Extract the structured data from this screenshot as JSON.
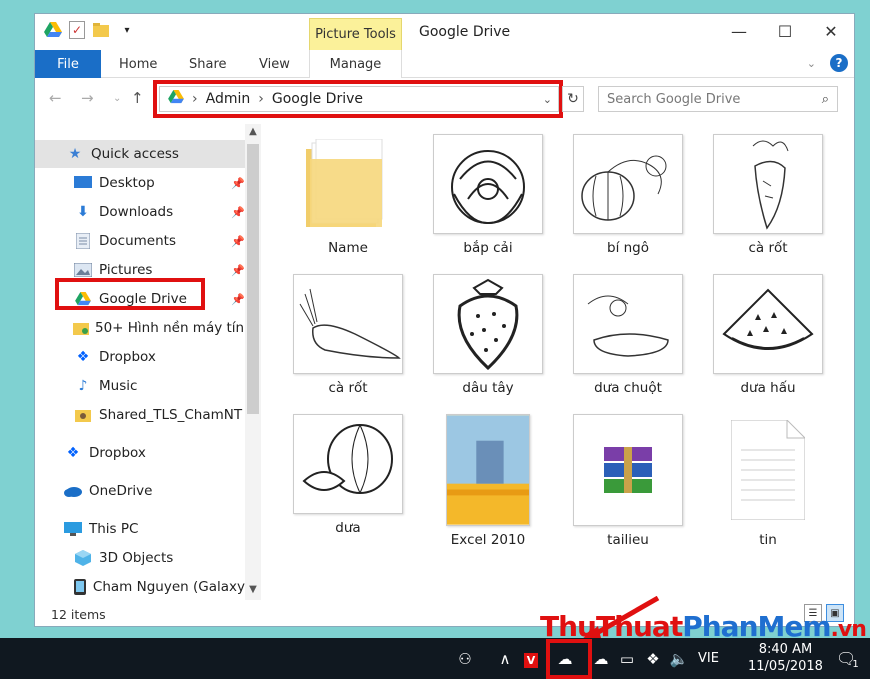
{
  "window": {
    "title": "Google Drive",
    "picture_tools": "Picture Tools",
    "controls": {
      "minimize": "—",
      "maximize": "☐",
      "close": "✕"
    }
  },
  "ribbon": {
    "tabs": [
      "File",
      "Home",
      "Share",
      "View",
      "Manage"
    ],
    "help": "?"
  },
  "address": {
    "crumbs": [
      "Admin",
      "Google Drive"
    ],
    "search_placeholder": "Search Google Drive"
  },
  "sidebar": {
    "items": [
      {
        "label": "Quick access",
        "icon": "star-icon"
      },
      {
        "label": "Desktop",
        "icon": "desktop-icon"
      },
      {
        "label": "Downloads",
        "icon": "download-icon"
      },
      {
        "label": "Documents",
        "icon": "documents-icon"
      },
      {
        "label": "Pictures",
        "icon": "pictures-icon"
      },
      {
        "label": "Google Drive",
        "icon": "google-drive-icon"
      },
      {
        "label": "50+ Hình nền máy tính",
        "icon": "folder-icon"
      },
      {
        "label": "Dropbox",
        "icon": "dropbox-icon"
      },
      {
        "label": "Music",
        "icon": "music-icon"
      },
      {
        "label": "Shared_TLS_ChamNT",
        "icon": "shared-folder-icon"
      },
      {
        "label": "Dropbox",
        "icon": "dropbox-icon"
      },
      {
        "label": "OneDrive",
        "icon": "onedrive-icon"
      },
      {
        "label": "This PC",
        "icon": "pc-icon"
      },
      {
        "label": "3D Objects",
        "icon": "3d-objects-icon"
      },
      {
        "label": "Cham Nguyen (Galaxy",
        "icon": "phone-icon"
      }
    ]
  },
  "files": [
    {
      "name": "Name",
      "kind": "folder"
    },
    {
      "name": "bắp cải",
      "kind": "image"
    },
    {
      "name": "bí ngô",
      "kind": "image"
    },
    {
      "name": "cà rốt",
      "kind": "image"
    },
    {
      "name": "cà rốt",
      "kind": "image"
    },
    {
      "name": "dâu tây",
      "kind": "image"
    },
    {
      "name": "dưa chuột",
      "kind": "image"
    },
    {
      "name": "dưa hấu",
      "kind": "image"
    },
    {
      "name": "dưa",
      "kind": "image"
    },
    {
      "name": "Excel 2010",
      "kind": "image"
    },
    {
      "name": "tailieu",
      "kind": "archive"
    },
    {
      "name": "tin",
      "kind": "document"
    }
  ],
  "status": {
    "count": "12 items"
  },
  "taskbar": {
    "lang": "VIE",
    "time": "8:40 AM",
    "date": "11/05/2018",
    "notif_count": "1"
  },
  "watermark": {
    "part1": "ThuThuat",
    "part2": "PhanMem",
    "part3": ".vn"
  }
}
